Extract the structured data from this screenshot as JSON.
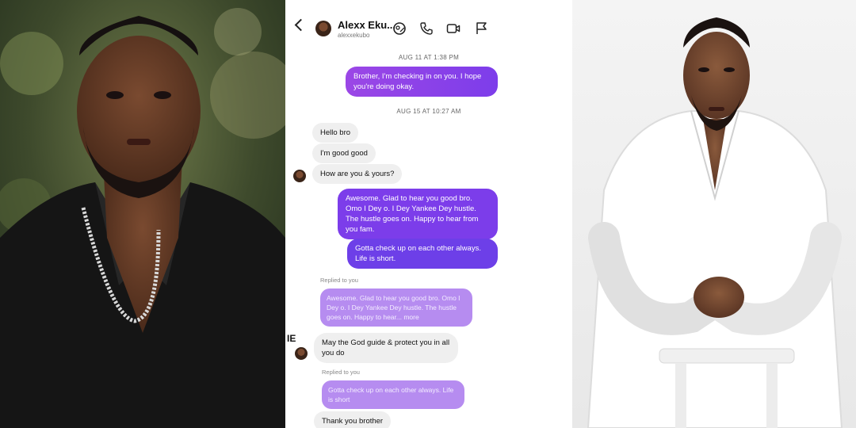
{
  "chat": {
    "contact_name": "Alexx Eku...",
    "contact_handle": "alexxekubo",
    "header_icons": [
      "back-icon",
      "sticker-icon",
      "phone-icon",
      "video-icon",
      "flag-icon"
    ],
    "edge_text": "IE",
    "messages": [
      {
        "kind": "timestamp",
        "text": "AUG 11 AT 1:38 PM"
      },
      {
        "kind": "outgoing",
        "text": "Brother, I'm checking in on you.  I hope you're doing okay."
      },
      {
        "kind": "timestamp",
        "text": "AUG 15 AT 10:27 AM"
      },
      {
        "kind": "incoming",
        "text": "Hello bro"
      },
      {
        "kind": "incoming",
        "text": "I'm good good"
      },
      {
        "kind": "incoming",
        "text": "How are you & yours?"
      },
      {
        "kind": "outgoing",
        "text": "Awesome. Glad to hear you good bro. Omo I Dey o.  I Dey Yankee Dey hustle. The hustle goes on.  Happy to hear from you fam."
      },
      {
        "kind": "outgoing",
        "text": "Gotta check up on each other always. Life is short."
      },
      {
        "kind": "replied_label",
        "text": "Replied to you"
      },
      {
        "kind": "quoted",
        "text": "Awesome. Glad to hear you good bro. Omo I Dey o. I Dey Yankee Dey hustle. The hustle goes on.  Happy to hear... more"
      },
      {
        "kind": "incoming",
        "text": "May the God guide & protect you in all you do"
      },
      {
        "kind": "replied_label",
        "text": "Replied to you"
      },
      {
        "kind": "quoted",
        "text": "Gotta check up on each other always. Life is short"
      },
      {
        "kind": "incoming",
        "text": "Thank you brother"
      }
    ]
  },
  "colors": {
    "outgoing_bubble": "#7c3dea",
    "incoming_bubble": "#efefef",
    "quoted_bubble": "#b68cf0"
  }
}
